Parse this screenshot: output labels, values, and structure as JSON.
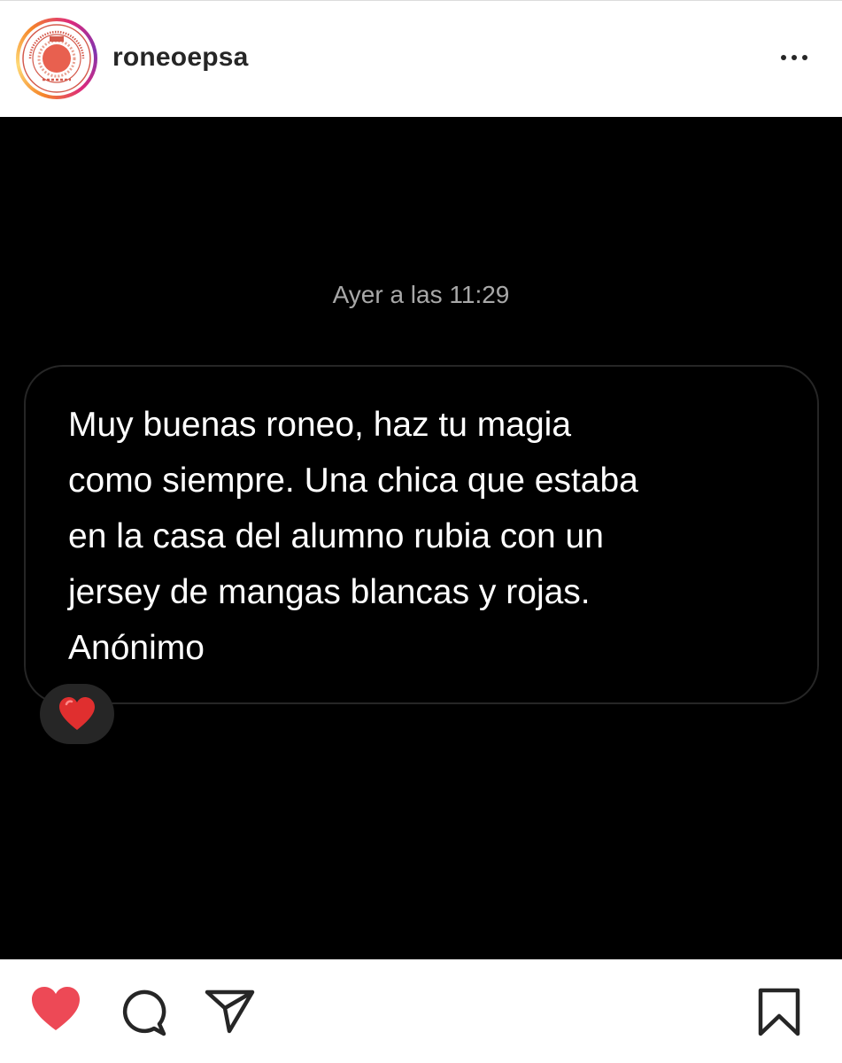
{
  "header": {
    "username": "roneoepsa",
    "avatar_icon": "university-seal-icon",
    "more_icon": "more-options-icon"
  },
  "post": {
    "timestamp": "Ayer a las 11:29",
    "message_lines": [
      "Muy buenas roneo, haz tu magia",
      "como siempre. Una chica que estaba",
      "en la casa del alumno rubia con un",
      "jersey de mangas blancas y rojas.",
      "Anónimo"
    ],
    "reaction": "❤️"
  },
  "actions": {
    "like_icon": "heart-icon",
    "comment_icon": "comment-icon",
    "share_icon": "share-icon",
    "save_icon": "bookmark-icon"
  },
  "colors": {
    "like": "#ed4956",
    "text": "#262626",
    "post_background": "#000000",
    "bubble_border": "#262626",
    "timestamp": "#a8a8a8"
  }
}
